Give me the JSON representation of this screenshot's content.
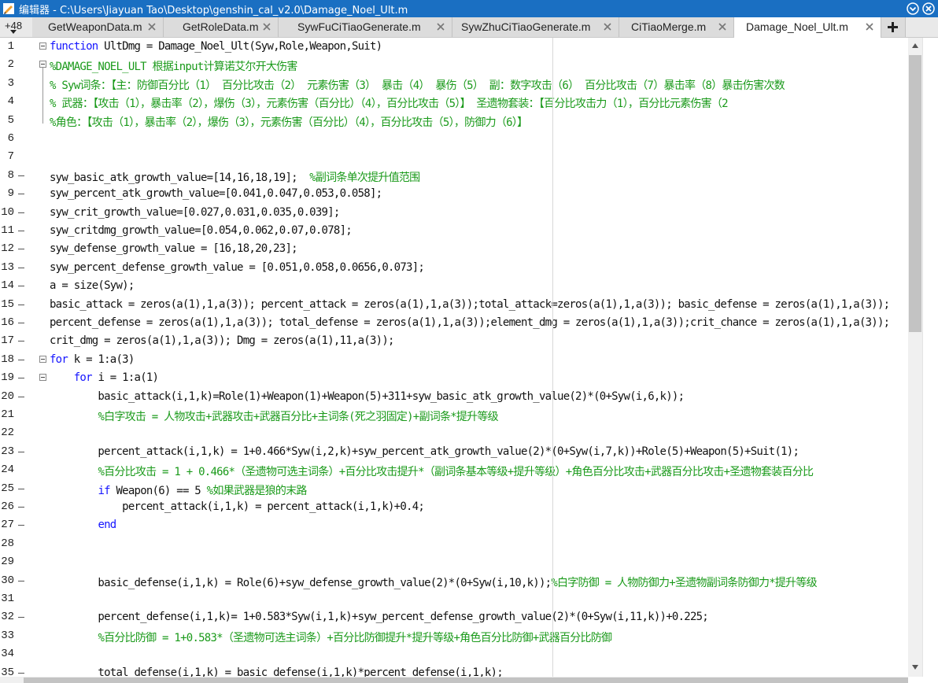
{
  "window": {
    "title": "编辑器 - C:\\Users\\Jiayuan Tao\\Desktop\\genshin_cal_v2.0\\Damage_Noel_Ult.m"
  },
  "tabs": {
    "hidden_count": "+48",
    "items": [
      {
        "label": "GetWeaponData.m"
      },
      {
        "label": "GetRoleData.m"
      },
      {
        "label": "SywFuCiTiaoGenerate.m"
      },
      {
        "label": "SywZhuCiTiaoGenerate.m"
      },
      {
        "label": "CiTiaoMerge.m"
      },
      {
        "label": "Damage_Noel_Ult.m"
      }
    ]
  },
  "editor": {
    "lines": [
      {
        "num": "1",
        "segs": [
          {
            "t": "function",
            "c": "kw"
          },
          {
            "t": " UltDmg = Damage_Noel_Ult(Syw,Role,Weapon,Suit)",
            "c": ""
          }
        ]
      },
      {
        "num": "2",
        "segs": [
          {
            "t": "%DAMAGE_NOEL_ULT 根据input计算诺艾尔开大伤害",
            "c": "cm"
          }
        ]
      },
      {
        "num": "3",
        "segs": [
          {
            "t": "% Syw词条：【主：防御百分比（1） 百分比攻击（2） 元素伤害（3） 暴击（4） 暴伤（5） 副：数字攻击（6） 百分比攻击（7）暴击率（8）暴击伤害次数",
            "c": "cm"
          }
        ]
      },
      {
        "num": "4",
        "segs": [
          {
            "t": "% 武器：【攻击（1），暴击率（2），爆伤（3），元素伤害（百分比）（4），百分比攻击（5）】 圣遗物套装：【百分比攻击力（1），百分比元素伤害（2",
            "c": "cm"
          }
        ]
      },
      {
        "num": "5",
        "segs": [
          {
            "t": "%角色：【攻击（1），暴击率（2），爆伤（3），元素伤害（百分比）（4），百分比攻击（5），防御力（6）】",
            "c": "cm"
          }
        ]
      },
      {
        "num": "6",
        "segs": []
      },
      {
        "num": "7",
        "segs": []
      },
      {
        "num": "8",
        "segs": [
          {
            "t": "syw_basic_atk_growth_value=[14,16,18,19];  ",
            "c": ""
          },
          {
            "t": "%副词条单次提升值范围",
            "c": "cm"
          }
        ]
      },
      {
        "num": "9",
        "segs": [
          {
            "t": "syw_percent_atk_growth_value=[0.041,0.047,0.053,0.058];",
            "c": ""
          }
        ]
      },
      {
        "num": "10",
        "segs": [
          {
            "t": "syw_crit_growth_value=[0.027,0.031,0.035,0.039];",
            "c": ""
          }
        ]
      },
      {
        "num": "11",
        "segs": [
          {
            "t": "syw_critdmg_growth_value=[0.054,0.062,0.07,0.078];",
            "c": ""
          }
        ]
      },
      {
        "num": "12",
        "segs": [
          {
            "t": "syw_defense_growth_value = [16,18,20,23];",
            "c": ""
          }
        ]
      },
      {
        "num": "13",
        "segs": [
          {
            "t": "syw_percent_defense_growth_value = [0.051,0.058,0.0656,0.073];",
            "c": ""
          }
        ]
      },
      {
        "num": "14",
        "segs": [
          {
            "t": "a = size(Syw);",
            "c": ""
          }
        ]
      },
      {
        "num": "15",
        "segs": [
          {
            "t": "basic_attack = zeros(a(1),1,a(3)); percent_attack = zeros(a(1),1,a(3));total_attack=zeros(a(1),1,a(3)); basic_defense = zeros(a(1),1,a(3));",
            "c": ""
          }
        ]
      },
      {
        "num": "16",
        "segs": [
          {
            "t": "percent_defense = zeros(a(1),1,a(3)); total_defense = zeros(a(1),1,a(3));element_dmg = zeros(a(1),1,a(3));crit_chance = zeros(a(1),1,a(3));",
            "c": ""
          }
        ]
      },
      {
        "num": "17",
        "segs": [
          {
            "t": "crit_dmg = zeros(a(1),1,a(3)); Dmg = zeros(a(1),11,a(3));",
            "c": ""
          }
        ]
      },
      {
        "num": "18",
        "segs": [
          {
            "t": "for",
            "c": "kw"
          },
          {
            "t": " k = 1:a(3)",
            "c": ""
          }
        ]
      },
      {
        "num": "19",
        "segs": [
          {
            "t": "    ",
            "c": ""
          },
          {
            "t": "for",
            "c": "kw"
          },
          {
            "t": " i = 1:a(1)",
            "c": ""
          }
        ]
      },
      {
        "num": "20",
        "segs": [
          {
            "t": "        basic_attack(i,1,k)=Role(1)+Weapon(1)+Weapon(5)+311+syw_basic_atk_growth_value(2)*(0+Syw(i,6,k));",
            "c": ""
          }
        ]
      },
      {
        "num": "21",
        "segs": [
          {
            "t": "        ",
            "c": ""
          },
          {
            "t": "%白字攻击 = 人物攻击+武器攻击+武器百分比+主词条(死之羽固定)+副词条*提升等级",
            "c": "cm"
          }
        ]
      },
      {
        "num": "22",
        "segs": []
      },
      {
        "num": "23",
        "segs": [
          {
            "t": "        percent_attack(i,1,k) = 1+0.466*Syw(i,2,k)+syw_percent_atk_growth_value(2)*(0+Syw(i,7,k))+Role(5)+Weapon(5)+Suit(1);",
            "c": ""
          }
        ]
      },
      {
        "num": "24",
        "segs": [
          {
            "t": "        ",
            "c": ""
          },
          {
            "t": "%百分比攻击 = 1 + 0.466*（圣遗物可选主词条）+百分比攻击提升*（副词条基本等级+提升等级）+角色百分比攻击+武器百分比攻击+圣遗物套装百分比",
            "c": "cm"
          }
        ]
      },
      {
        "num": "25",
        "segs": [
          {
            "t": "        ",
            "c": ""
          },
          {
            "t": "if",
            "c": "kw"
          },
          {
            "t": " Weapon(6) == 5 ",
            "c": ""
          },
          {
            "t": "%如果武器是狼的末路",
            "c": "cm"
          }
        ]
      },
      {
        "num": "26",
        "segs": [
          {
            "t": "            percent_attack(i,1,k) = percent_attack(i,1,k)+0.4;",
            "c": ""
          }
        ]
      },
      {
        "num": "27",
        "segs": [
          {
            "t": "        ",
            "c": ""
          },
          {
            "t": "end",
            "c": "kw"
          }
        ]
      },
      {
        "num": "28",
        "segs": []
      },
      {
        "num": "29",
        "segs": []
      },
      {
        "num": "30",
        "segs": [
          {
            "t": "        basic_defense(i,1,k) = Role(6)+syw_defense_growth_value(2)*(0+Syw(i,10,k));",
            "c": ""
          },
          {
            "t": "%白字防御 = 人物防御力+圣遗物副词条防御力*提升等级",
            "c": "cm"
          }
        ]
      },
      {
        "num": "31",
        "segs": []
      },
      {
        "num": "32",
        "segs": [
          {
            "t": "        percent_defense(i,1,k)= 1+0.583*Syw(i,1,k)+syw_percent_defense_growth_value(2)*(0+Syw(i,11,k))+0.225;",
            "c": ""
          }
        ]
      },
      {
        "num": "33",
        "segs": [
          {
            "t": "        ",
            "c": ""
          },
          {
            "t": "%百分比防御 = 1+0.583*（圣遗物可选主词条）+百分比防御提升*提升等级+角色百分比防御+武器百分比防御",
            "c": "cm"
          }
        ]
      },
      {
        "num": "34",
        "segs": []
      },
      {
        "num": "35",
        "segs": [
          {
            "t": "        total_defense(i,1,k) = basic_defense(i,1,k)*percent_defense(i,1,k);",
            "c": ""
          }
        ]
      }
    ]
  }
}
